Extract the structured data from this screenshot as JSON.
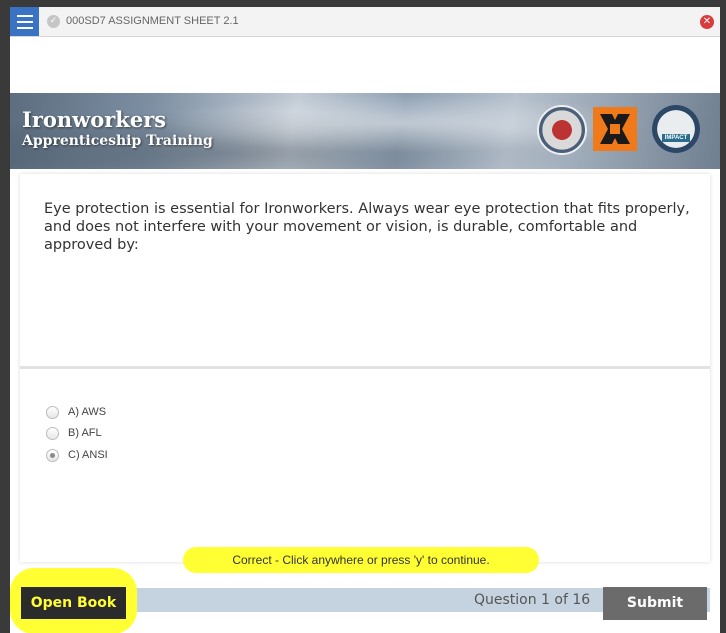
{
  "window": {
    "title": "000SD7 ASSIGNMENT SHEET 2.1"
  },
  "icons": {
    "menu": "hamburger-menu-icon",
    "status": "check-circle-icon",
    "close": "close-circle-icon"
  },
  "banner": {
    "title_line1": "Ironworkers",
    "title_line2": "Apprenticeship Training",
    "impact_label": "IMPACT"
  },
  "question": {
    "text": "Eye protection is essential for Ironworkers. Always wear eye protection that fits properly, and does not interfere with your movement or vision, is durable, comfortable and approved by:",
    "options": [
      {
        "label": "A) AWS",
        "selected": false
      },
      {
        "label": "B) AFL",
        "selected": false
      },
      {
        "label": "C) ANSI",
        "selected": true
      }
    ]
  },
  "feedback": {
    "text": "Correct - Click anywhere or press 'y' to continue."
  },
  "footer": {
    "open_book_label": "Open Book",
    "question_counter": "Question 1 of 16",
    "submit_label": "Submit"
  },
  "colors": {
    "accent": "#3b73c4",
    "highlight": "#ffff33",
    "close": "#d93c3c",
    "footer_bar": "#c5d3e0",
    "submit": "#6b6b6b"
  }
}
